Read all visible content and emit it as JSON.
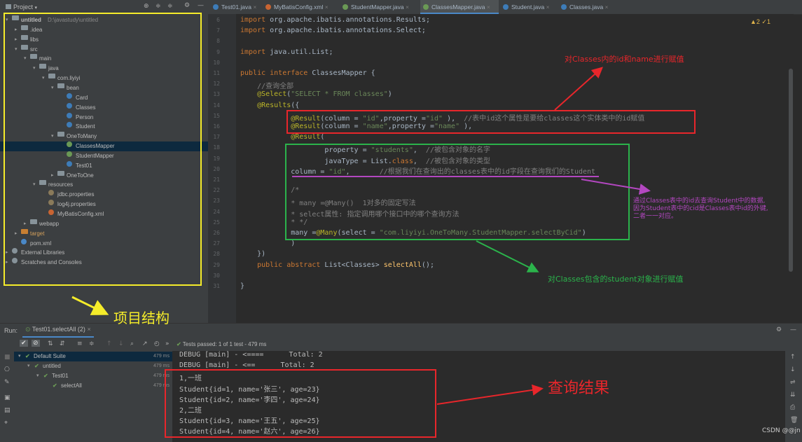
{
  "tabs": [
    {
      "label": "Test01.java",
      "color": "#3d7cb8",
      "active": false
    },
    {
      "label": "MyBatisConfig.xml",
      "color": "#c86432",
      "active": false
    },
    {
      "label": "StudentMapper.java",
      "color": "#6a9955",
      "active": false
    },
    {
      "label": "ClassesMapper.java",
      "color": "#6a9955",
      "active": true
    },
    {
      "label": "Student.java",
      "color": "#3d7cb8",
      "active": false
    },
    {
      "label": "Classes.java",
      "color": "#3d7cb8",
      "active": false
    }
  ],
  "project": {
    "title": "Project",
    "tree": [
      {
        "label": "untitled",
        "extra": "D:\\javastudy\\untitled",
        "indent": 0,
        "arrow": "▾",
        "type": "folder",
        "bold": true
      },
      {
        "label": ".idea",
        "indent": 1,
        "arrow": "▸",
        "type": "folder"
      },
      {
        "label": "libs",
        "indent": 1,
        "arrow": "▸",
        "type": "folder"
      },
      {
        "label": "src",
        "indent": 1,
        "arrow": "▾",
        "type": "folder"
      },
      {
        "label": "main",
        "indent": 2,
        "arrow": "▾",
        "type": "folder"
      },
      {
        "label": "java",
        "indent": 3,
        "arrow": "▾",
        "type": "folder"
      },
      {
        "label": "com.liyiyi",
        "indent": 4,
        "arrow": "▾",
        "type": "folder"
      },
      {
        "label": "bean",
        "indent": 5,
        "arrow": "▾",
        "type": "folder"
      },
      {
        "label": "Card",
        "indent": 6,
        "arrow": "",
        "type": "class"
      },
      {
        "label": "Classes",
        "indent": 6,
        "arrow": "",
        "type": "class"
      },
      {
        "label": "Person",
        "indent": 6,
        "arrow": "",
        "type": "class"
      },
      {
        "label": "Student",
        "indent": 6,
        "arrow": "",
        "type": "class"
      },
      {
        "label": "OneToMany",
        "indent": 5,
        "arrow": "▾",
        "type": "folder"
      },
      {
        "label": "ClassesMapper",
        "indent": 6,
        "arrow": "",
        "type": "iface",
        "selected": true
      },
      {
        "label": "StudentMapper",
        "indent": 6,
        "arrow": "",
        "type": "iface"
      },
      {
        "label": "Test01",
        "indent": 6,
        "arrow": "",
        "type": "class"
      },
      {
        "label": "OneToOne",
        "indent": 5,
        "arrow": "▸",
        "type": "folder"
      },
      {
        "label": "resources",
        "indent": 3,
        "arrow": "▾",
        "type": "folder"
      },
      {
        "label": "jdbc.properties",
        "indent": 4,
        "arrow": "",
        "type": "file"
      },
      {
        "label": "log4j.properties",
        "indent": 4,
        "arrow": "",
        "type": "file"
      },
      {
        "label": "MyBatisConfig.xml",
        "indent": 4,
        "arrow": "",
        "type": "xml"
      },
      {
        "label": "webapp",
        "indent": 2,
        "arrow": "▸",
        "type": "folder"
      },
      {
        "label": "target",
        "indent": 1,
        "arrow": "▸",
        "type": "folder",
        "orange": true
      },
      {
        "label": "pom.xml",
        "indent": 1,
        "arrow": "",
        "type": "maven"
      },
      {
        "label": "External Libraries",
        "indent": 0,
        "arrow": "▸",
        "type": "lib"
      },
      {
        "label": "Scratches and Consoles",
        "indent": 0,
        "arrow": "▸",
        "type": "lib"
      }
    ]
  },
  "editor": {
    "line_numbers": [
      "6",
      "7",
      "8",
      "9",
      "10",
      "11",
      "12",
      "13",
      "14",
      "15",
      "16",
      "17",
      "18",
      "19",
      "20",
      "21",
      "22",
      "23",
      "24",
      "25",
      "26",
      "27",
      "28",
      "29",
      "30",
      "31"
    ],
    "inspection": "▲2 ✓1",
    "lines": [
      [
        [
          "kw",
          "import "
        ],
        [
          "",
          "org.apache.ibatis.annotations."
        ],
        [
          "",
          "Results"
        ],
        [
          "",
          ";"
        ]
      ],
      [
        [
          "kw",
          "import "
        ],
        [
          "",
          "org.apache.ibatis.annotations."
        ],
        [
          "",
          "Select"
        ],
        [
          "",
          ";"
        ]
      ],
      [],
      [
        [
          "kw",
          "import "
        ],
        [
          "",
          "java.util.List;"
        ]
      ],
      [],
      [
        [
          "kw",
          "public interface "
        ],
        [
          "",
          "ClassesMapper {"
        ]
      ],
      [
        [
          "cmt",
          "    //查询全部"
        ]
      ],
      [
        [
          "ann",
          "    @Select"
        ],
        [
          "",
          "("
        ],
        [
          "str",
          "\"SELECT * FROM classes\""
        ],
        [
          "",
          ")"
        ]
      ],
      [
        [
          "ann",
          "    @Results"
        ],
        [
          "",
          "({"
        ]
      ],
      [
        [
          "ann",
          "            @Result"
        ],
        [
          "",
          "(column = "
        ],
        [
          "str",
          "\"id\""
        ],
        [
          "",
          ",property ="
        ],
        [
          "str",
          "\"id\""
        ],
        [
          "",
          " ),  "
        ],
        [
          "cmt",
          "//表中id这个属性是要给classes这个实体类中的id赋值"
        ]
      ],
      [
        [
          "ann",
          "            @Result"
        ],
        [
          "",
          "(column = "
        ],
        [
          "str",
          "\"name\""
        ],
        [
          "",
          ",property ="
        ],
        [
          "str",
          "\"name\""
        ],
        [
          "",
          " ),"
        ]
      ],
      [
        [
          "ann",
          "            @Result"
        ],
        [
          "",
          "("
        ]
      ],
      [
        [
          "",
          "                    property = "
        ],
        [
          "str",
          "\"students\""
        ],
        [
          "",
          ",  "
        ],
        [
          "cmt",
          "//被包含对象的名字"
        ]
      ],
      [
        [
          "",
          "                    javaType = List."
        ],
        [
          "kw",
          "class"
        ],
        [
          "",
          ",  "
        ],
        [
          "cmt",
          "//被包含对象的类型"
        ]
      ],
      [
        [
          "",
          "            column = "
        ],
        [
          "str",
          "\"id\""
        ],
        [
          "",
          ",       "
        ],
        [
          "cmt",
          "//根据我们在查询出的classes表中的id字段在查询我们的Student"
        ]
      ],
      [],
      [
        [
          "cmt",
          "            /*"
        ]
      ],
      [
        [
          "cmt",
          "            * many =@Many()  1对多的固定写法"
        ]
      ],
      [
        [
          "cmt",
          "            * select属性: 指定调用哪个接口中的哪个查询方法"
        ]
      ],
      [
        [
          "cmt",
          "            * */"
        ]
      ],
      [
        [
          "",
          "            many ="
        ],
        [
          "ann",
          "@Many"
        ],
        [
          "",
          "(select = "
        ],
        [
          "str",
          "\"com.liyiyi.OneToMany.StudentMapper.selectByCid\""
        ],
        [
          "",
          ")"
        ]
      ],
      [
        [
          "",
          "            )"
        ]
      ],
      [
        [
          "",
          "    })"
        ]
      ],
      [
        [
          "kw",
          "    public abstract "
        ],
        [
          "",
          "List<Classes> "
        ],
        [
          "fn",
          "selectAll"
        ],
        [
          "",
          "();"
        ]
      ],
      [],
      [
        [
          "",
          "}"
        ]
      ]
    ]
  },
  "annotations": {
    "a1": "对Classes内的id和name进行赋值",
    "a2_lines": [
      "通过Classes表中的id去查询Student中的数据,",
      "因为Student表中的cid是Classes表中id的外键,",
      "二者一一对应。"
    ],
    "a3": "对Classes包含的student对象进行赋值",
    "a4": "项目结构",
    "a5": "查询结果"
  },
  "run": {
    "label": "Run:",
    "tab": "Test01.selectAll (2)",
    "status": "Tests passed: 1 of 1 test - 479 ms",
    "tests": [
      {
        "label": "Default Suite",
        "time": "479 ms",
        "indent": 0
      },
      {
        "label": "untitled",
        "time": "479 ms",
        "indent": 1
      },
      {
        "label": "Test01",
        "time": "479 ms",
        "indent": 2
      },
      {
        "label": "selectAll",
        "time": "479 ms",
        "indent": 3
      }
    ],
    "console": [
      "DEBUG [main] - <====      Total: 2",
      "DEBUG [main] - <==      Total: 2",
      "1,一班",
      "Student{id=1, name='张三', age=23}",
      "Student{id=2, name='李四', age=24}",
      "2,二班",
      "Student{id=3, name='王五', age=25}",
      "Student{id=4, name='赵六', age=26}"
    ]
  },
  "watermark": "CSDN @@jn"
}
